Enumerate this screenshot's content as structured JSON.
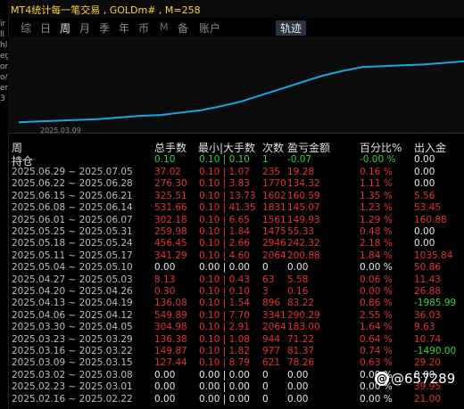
{
  "window": {
    "title": "MT4统计每一笔交易 , GOLDm# , M=258"
  },
  "left_strip": [
    "ir",
    "ll",
    "hl",
    "eg",
    "or",
    "o/",
    "er",
    "3"
  ],
  "tabs": [
    {
      "label": "综",
      "state": "normal"
    },
    {
      "label": "日",
      "state": "normal"
    },
    {
      "label": "周",
      "state": "active"
    },
    {
      "label": "月",
      "state": "normal"
    },
    {
      "label": "季",
      "state": "normal"
    },
    {
      "label": "年",
      "state": "normal"
    },
    {
      "label": "币",
      "state": "normal"
    },
    {
      "label": "M",
      "state": "dim"
    },
    {
      "label": "备",
      "state": "normal"
    },
    {
      "label": "账户",
      "state": "normal"
    },
    {
      "label": "轨迹",
      "state": "trace"
    }
  ],
  "equity_chart": {
    "start_date": "2025.03.09",
    "line_color": "#19a6e0",
    "points": [
      0.02,
      0.03,
      0.04,
      0.05,
      0.06,
      0.08,
      0.1,
      0.11,
      0.14,
      0.17,
      0.22,
      0.28,
      0.36,
      0.44,
      0.52,
      0.6,
      0.66,
      0.71,
      0.72,
      0.73,
      0.74,
      0.76,
      0.78
    ]
  },
  "columns": {
    "week": "周",
    "profit_factor": "总手数",
    "min_max": "最小|大手数",
    "count": "次数",
    "pl": "盈亏金额",
    "pct": "百分比%",
    "io": "出入金"
  },
  "position_row": {
    "week": "持仓",
    "pf": "0.10",
    "range": "0.10 | 0.10",
    "cnt": "1",
    "pl": "-0.07",
    "pct": "-0.00 %",
    "io": "0.00"
  },
  "rows": [
    {
      "week": "2025.06.29 ~ 2025.07.05",
      "pf": "37.02",
      "range": "0.10 | 1.07",
      "cnt": "235",
      "pl": "19.28",
      "pct": "0.16 %",
      "io": "0.00",
      "tone": "red",
      "io_tone": "white"
    },
    {
      "week": "2025.06.22 ~ 2025.06.28",
      "pf": "276.30",
      "range": "0.10 | 3.83",
      "cnt": "1770",
      "pl": "134.32",
      "pct": "1.11 %",
      "io": "0.00",
      "tone": "red",
      "io_tone": "white"
    },
    {
      "week": "2025.06.15 ~ 2025.06.21",
      "pf": "325.51",
      "range": "0.10 | 13.73",
      "cnt": "1602",
      "pl": "160.59",
      "pct": "1.35 %",
      "io": "5.56",
      "tone": "red",
      "io_tone": "red"
    },
    {
      "week": "2025.06.08 ~ 2025.06.14",
      "pf": "531.66",
      "range": "0.10 | 41.35",
      "cnt": "1831",
      "pl": "145.07",
      "pct": "1.23 %",
      "io": "53.45",
      "tone": "red",
      "io_tone": "red"
    },
    {
      "week": "2025.06.01 ~ 2025.06.07",
      "pf": "302.18",
      "range": "0.10 | 6.65",
      "cnt": "1561",
      "pl": "149.93",
      "pct": "1.29 %",
      "io": "160.88",
      "tone": "red",
      "io_tone": "red"
    },
    {
      "week": "2025.05.25 ~ 2025.05.31",
      "pf": "259.98",
      "range": "0.10 | 1.84",
      "cnt": "1475",
      "pl": "55.33",
      "pct": "0.48 %",
      "io": "0.00",
      "tone": "red",
      "io_tone": "white"
    },
    {
      "week": "2025.05.18 ~ 2025.05.24",
      "pf": "456.45",
      "range": "0.10 | 2.66",
      "cnt": "2946",
      "pl": "242.32",
      "pct": "2.18 %",
      "io": "0.00",
      "tone": "red",
      "io_tone": "white"
    },
    {
      "week": "2025.05.11 ~ 2025.05.17",
      "pf": "341.29",
      "range": "0.10 | 4.60",
      "cnt": "2064",
      "pl": "200.88",
      "pct": "1.84 %",
      "io": "1035.84",
      "tone": "red",
      "io_tone": "red"
    },
    {
      "week": "2025.05.04 ~ 2025.05.10",
      "pf": "0.00",
      "range": "0.00 | 0.00",
      "cnt": "0",
      "pl": "0.00",
      "pct": "0.00 %",
      "io": "50.86",
      "tone": "white",
      "io_tone": "red"
    },
    {
      "week": "2025.04.27 ~ 2025.05.03",
      "pf": "8.13",
      "range": "0.10 | 0.43",
      "cnt": "63",
      "pl": "5.58",
      "pct": "0.06 %",
      "io": "11.43",
      "tone": "red",
      "io_tone": "red"
    },
    {
      "week": "2025.04.20 ~ 2025.04.26",
      "pf": "0.30",
      "range": "0.10 | 0.10",
      "cnt": "3",
      "pl": "0.16",
      "pct": "0.00 %",
      "io": "26.88",
      "tone": "red",
      "io_tone": "red"
    },
    {
      "week": "2025.04.13 ~ 2025.04.19",
      "pf": "136.08",
      "range": "0.10 | 1.54",
      "cnt": "896",
      "pl": "83.22",
      "pct": "0.86 %",
      "io": "-1985.99",
      "tone": "red",
      "io_tone": "green"
    },
    {
      "week": "2025.04.06 ~ 2025.04.12",
      "pf": "549.89",
      "range": "0.10 | 7.70",
      "cnt": "3341",
      "pl": "290.29",
      "pct": "2.55 %",
      "io": "36.03",
      "tone": "red",
      "io_tone": "red"
    },
    {
      "week": "2025.03.30 ~ 2025.04.05",
      "pf": "304.98",
      "range": "0.10 | 2.91",
      "cnt": "2064",
      "pl": "183.00",
      "pct": "1.64 %",
      "io": "9.63",
      "tone": "red",
      "io_tone": "red"
    },
    {
      "week": "2025.03.23 ~ 2025.03.29",
      "pf": "136.38",
      "range": "0.10 | 1.08",
      "cnt": "944",
      "pl": "71.22",
      "pct": "0.64 %",
      "io": "10.74",
      "tone": "red",
      "io_tone": "red"
    },
    {
      "week": "2025.03.16 ~ 2025.03.22",
      "pf": "149.87",
      "range": "0.10 | 1.82",
      "cnt": "977",
      "pl": "81.37",
      "pct": "0.74 %",
      "io": "-1490.00",
      "tone": "red",
      "io_tone": "green"
    },
    {
      "week": "2025.03.09 ~ 2025.03.15",
      "pf": "127.44",
      "range": "0.10 | 8.79",
      "cnt": "621",
      "pl": "78.26",
      "pct": "0.63 %",
      "io": "29.20",
      "tone": "red",
      "io_tone": "red"
    },
    {
      "week": "2025.03.02 ~ 2025.03.08",
      "pf": "0.00",
      "range": "0.00 | 0.00",
      "cnt": "0",
      "pl": "0.00",
      "pct": "0.00 %",
      "io": "0.00",
      "tone": "white",
      "io_tone": "white"
    },
    {
      "week": "2025.02.23 ~ 2025.03.01",
      "pf": "0.00",
      "range": "0.00 | 0.00",
      "cnt": "0",
      "pl": "0.00",
      "pct": "0.00 %",
      "io": "39.95",
      "tone": "white",
      "io_tone": "red"
    },
    {
      "week": "2025.02.16 ~ 2025.02.22",
      "pf": "0.00",
      "range": "0.00 | 0.00",
      "cnt": "0",
      "pl": "0.00",
      "pct": "0.00 %",
      "io": "21.00",
      "tone": "white",
      "io_tone": "red"
    }
  ],
  "watermark": {
    "icon": "threads-icon",
    "text": "@657289"
  }
}
